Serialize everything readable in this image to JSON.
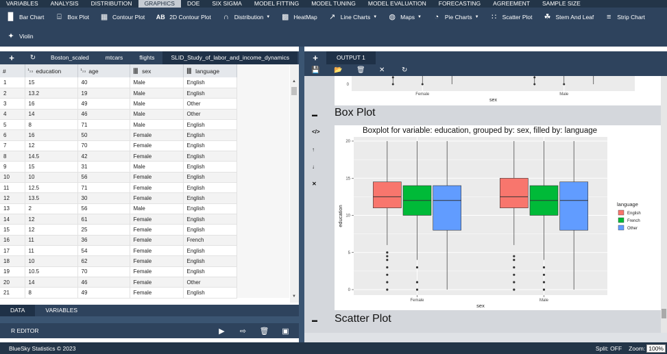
{
  "menu": [
    "VARIABLES",
    "ANALYSIS",
    "DISTRIBUTION",
    "GRAPHICS",
    "DOE",
    "SIX SIGMA",
    "MODEL FITTING",
    "MODEL TUNING",
    "MODEL EVALUATION",
    "FORECASTING",
    "AGREEMENT",
    "SAMPLE SIZE"
  ],
  "menu_active": "GRAPHICS",
  "toolbar": {
    "row1": [
      {
        "label": "Bar Chart",
        "icon": "bar-chart-icon"
      },
      {
        "label": "Box Plot",
        "icon": "box-plot-icon"
      },
      {
        "label": "Contour Plot",
        "icon": "contour-plot-icon"
      },
      {
        "label": "2D Contour Plot",
        "icon": "ab-icon"
      },
      {
        "label": "Distribution",
        "icon": "distribution-icon",
        "dropdown": true
      },
      {
        "label": "HeatMap",
        "icon": "heatmap-icon"
      },
      {
        "label": "Line Charts",
        "icon": "line-chart-icon",
        "dropdown": true
      },
      {
        "label": "Maps",
        "icon": "globe-icon",
        "dropdown": true
      },
      {
        "label": "Pie Charts",
        "icon": "pie-chart-icon",
        "dropdown": true
      },
      {
        "label": "Scatter Plot",
        "icon": "scatter-plot-icon"
      },
      {
        "label": "Stem And Leaf",
        "icon": "stem-leaf-icon"
      },
      {
        "label": "Strip Chart",
        "icon": "strip-chart-icon"
      }
    ],
    "row2": [
      {
        "label": "Violin",
        "icon": "violin-icon"
      }
    ]
  },
  "datasets": [
    "Boston_scaled",
    "mtcars",
    "flights",
    "SLID_Study_of_labor_and_income_dynamics"
  ],
  "dataset_active": "SLID_Study_of_labor_and_income_dynamics",
  "grid": {
    "columns": [
      {
        "name": "#",
        "type": ""
      },
      {
        "name": "education",
        "type": "numeric"
      },
      {
        "name": "age",
        "type": "numeric"
      },
      {
        "name": "sex",
        "type": "factor"
      },
      {
        "name": "language",
        "type": "factor"
      }
    ],
    "rows": [
      [
        "1",
        "15",
        "40",
        "Male",
        "English"
      ],
      [
        "2",
        "13.2",
        "19",
        "Male",
        "English"
      ],
      [
        "3",
        "16",
        "49",
        "Male",
        "Other"
      ],
      [
        "4",
        "14",
        "46",
        "Male",
        "Other"
      ],
      [
        "5",
        "8",
        "71",
        "Male",
        "English"
      ],
      [
        "6",
        "16",
        "50",
        "Female",
        "English"
      ],
      [
        "7",
        "12",
        "70",
        "Female",
        "English"
      ],
      [
        "8",
        "14.5",
        "42",
        "Female",
        "English"
      ],
      [
        "9",
        "15",
        "31",
        "Male",
        "English"
      ],
      [
        "10",
        "10",
        "56",
        "Female",
        "English"
      ],
      [
        "11",
        "12.5",
        "71",
        "Female",
        "English"
      ],
      [
        "12",
        "13.5",
        "30",
        "Female",
        "English"
      ],
      [
        "13",
        "2",
        "56",
        "Male",
        "English"
      ],
      [
        "14",
        "12",
        "61",
        "Female",
        "English"
      ],
      [
        "15",
        "12",
        "25",
        "Female",
        "English"
      ],
      [
        "16",
        "11",
        "36",
        "Female",
        "French"
      ],
      [
        "17",
        "11",
        "54",
        "Female",
        "English"
      ],
      [
        "18",
        "10",
        "62",
        "Female",
        "English"
      ],
      [
        "19",
        "10.5",
        "70",
        "Female",
        "English"
      ],
      [
        "20",
        "14",
        "46",
        "Female",
        "Other"
      ],
      [
        "21",
        "8",
        "49",
        "Female",
        "English"
      ]
    ]
  },
  "bottom_tabs": [
    "DATA",
    "VARIABLES"
  ],
  "bottom_active": "DATA",
  "r_editor_label": "R EDITOR",
  "output": {
    "tab": "OUTPUT 1",
    "section_box": "Box Plot",
    "section_scatter": "Scatter Plot"
  },
  "status": {
    "copyright": "BlueSky Statistics © 2023",
    "split": "Split: OFF",
    "zoom_label": "Zoom:",
    "zoom_value": "100%"
  },
  "chart_data": [
    {
      "type": "box",
      "title": "",
      "xlabel": "sex",
      "ylabel": "",
      "categories": [
        "Female",
        "Male"
      ],
      "partial": true,
      "visible_points": {
        "Female": [
          0
        ],
        "Male": [
          0
        ]
      }
    },
    {
      "type": "box",
      "title": "Boxplot for variable: education, grouped by: sex, filled by: language",
      "xlabel": "sex",
      "ylabel": "education",
      "ylim": [
        0,
        20
      ],
      "yticks": [
        0,
        5,
        10,
        15,
        20
      ],
      "categories": [
        "Female",
        "Male"
      ],
      "legend_title": "language",
      "legend_position": "right",
      "series": [
        {
          "name": "English",
          "color": "#f8766d",
          "boxes": [
            {
              "min": 6,
              "q1": 11,
              "median": 12.5,
              "q3": 14.5,
              "max": 20,
              "outliers": [
                0,
                1,
                2,
                3,
                4,
                4.5,
                5
              ]
            },
            {
              "min": 6,
              "q1": 11,
              "median": 12.5,
              "q3": 15,
              "max": 20,
              "outliers": [
                0,
                1,
                2,
                3,
                4,
                4.5
              ]
            }
          ]
        },
        {
          "name": "French",
          "color": "#00ba38",
          "boxes": [
            {
              "min": 4,
              "q1": 10,
              "median": 12,
              "q3": 14,
              "max": 20,
              "outliers": [
                0,
                1,
                3
              ]
            },
            {
              "min": 4,
              "q1": 10,
              "median": 12,
              "q3": 14,
              "max": 20,
              "outliers": [
                0,
                1,
                2,
                3
              ]
            }
          ]
        },
        {
          "name": "Other",
          "color": "#619cff",
          "boxes": [
            {
              "min": 0,
              "q1": 8,
              "median": 12,
              "q3": 14,
              "max": 20,
              "outliers": []
            },
            {
              "min": 0,
              "q1": 8,
              "median": 12,
              "q3": 14.5,
              "max": 20,
              "outliers": []
            }
          ]
        }
      ]
    }
  ]
}
